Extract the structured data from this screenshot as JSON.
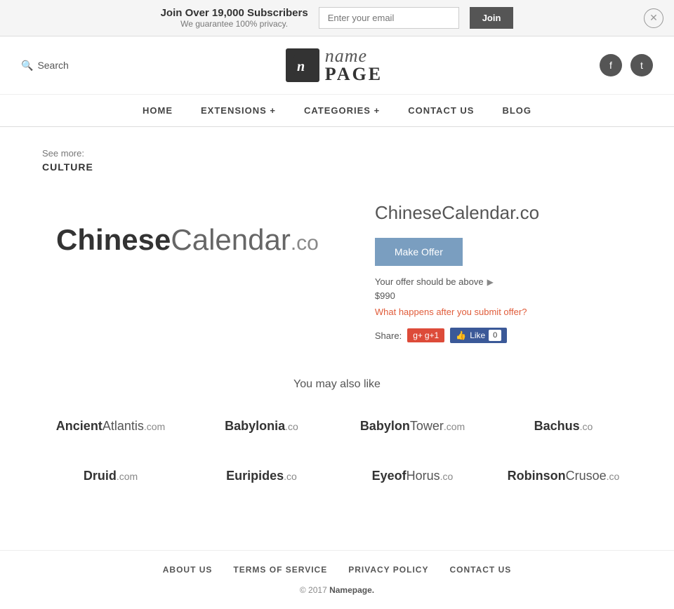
{
  "topBanner": {
    "headline": "Join Over 19,000 Subscribers",
    "subtext": "We guarantee 100% privacy.",
    "emailPlaceholder": "Enter your email",
    "joinLabel": "Join"
  },
  "header": {
    "searchLabel": "Search",
    "logoIcon": "n",
    "logoName": "name",
    "logoPage": "PAGE",
    "socialFacebook": "f",
    "socialTwitter": "t"
  },
  "nav": {
    "items": [
      {
        "label": "HOME",
        "id": "home"
      },
      {
        "label": "EXTENSIONS +",
        "id": "extensions"
      },
      {
        "label": "CATEGORIES +",
        "id": "categories"
      },
      {
        "label": "CONTACT US",
        "id": "contact"
      },
      {
        "label": "BLOG",
        "id": "blog"
      }
    ]
  },
  "breadcrumb": {
    "seeMore": "See more:",
    "category": "CULTURE"
  },
  "domain": {
    "nameBold": "Chinese",
    "nameLight": "Calendar",
    "tld": ".co",
    "fullName": "ChineseCalendar.co",
    "makeOfferLabel": "Make Offer",
    "offerShouldBeAbove": "Your offer should be above",
    "offerPrice": "$990",
    "whatHappens": "What happens after you submit offer?",
    "shareLabel": "Share:"
  },
  "alsoLike": {
    "title": "You may also like",
    "items": [
      {
        "bold": "Ancient",
        "light": "Atlantis",
        "tld": ".com"
      },
      {
        "bold": "Babylonia",
        "light": "",
        "tld": ".co"
      },
      {
        "bold": "Babylon",
        "light": "Tower",
        "tld": ".com"
      },
      {
        "bold": "Bachus",
        "light": "",
        "tld": ".co"
      },
      {
        "bold": "Druid",
        "light": "",
        "tld": ".com"
      },
      {
        "bold": "Euripides",
        "light": "",
        "tld": ".co"
      },
      {
        "bold": "Eyeof",
        "light": "Horus",
        "tld": ".co"
      },
      {
        "bold": "Robinson",
        "light": "Crusoe",
        "tld": ".co"
      }
    ]
  },
  "footer": {
    "links": [
      {
        "label": "ABOUT US",
        "id": "about-us"
      },
      {
        "label": "TERMS OF SERVICE",
        "id": "terms"
      },
      {
        "label": "PRIVACY POLICY",
        "id": "privacy"
      },
      {
        "label": "CONTACT US",
        "id": "contact-us"
      }
    ],
    "copyright": "© 2017",
    "brandName": "Namepage."
  },
  "social": {
    "gplus": "g+1",
    "fbLike": "Like",
    "fbCount": "0"
  }
}
